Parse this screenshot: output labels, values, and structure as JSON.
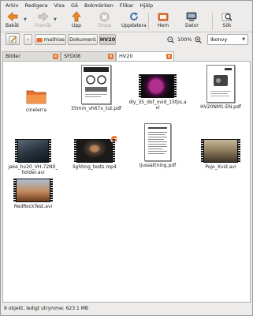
{
  "menu": [
    "Arkiv",
    "Redigera",
    "Visa",
    "Gå",
    "Bokmärken",
    "Flikar",
    "Hjälp"
  ],
  "toolbar": {
    "back": "Bakåt",
    "forward": "Framåt",
    "up": "Upp",
    "stop": "Stopp",
    "reload": "Uppdatera",
    "home": "Hem",
    "computer": "Dator",
    "search": "Sök"
  },
  "location": {
    "crumbs": [
      "mathias",
      "Dokument",
      "HV20"
    ],
    "zoom": "100%",
    "view": "Ikonvy"
  },
  "tabs": [
    "Bilder",
    "SFD08",
    "HV20"
  ],
  "files": [
    {
      "name": "cinelerra"
    },
    {
      "name": "35mm_vh67x_tut.pdf"
    },
    {
      "name": "diy_35_dof_xvid_15fps.avi"
    },
    {
      "name": "HV20NM1-EN.pdf"
    },
    {
      "name": "jake_hv20_VH-72N0_holder.avi"
    },
    {
      "name": "lighting_tests.mp4"
    },
    {
      "name": "ljussattning.pdf"
    },
    {
      "name": "Pojo_Xvid.avi"
    },
    {
      "name": "RedRockTest.avi"
    }
  ],
  "status": "9 objekt, ledigt utrymme: 623.1 MB"
}
